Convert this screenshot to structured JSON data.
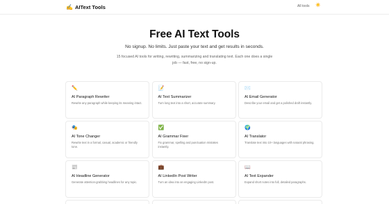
{
  "header": {
    "brand_icon": "✍️",
    "brand_name": "AIText Tools",
    "nav_link": "All tools",
    "theme_toggle_icon": "☀️"
  },
  "hero": {
    "title": "Free AI Text Tools",
    "subtitle": "No signup. No limits. Just paste your text and get results in seconds.",
    "description": "15 focused AI tools for writing, rewriting, summarizing and translating text. Each one does a single job — fast, free, no sign-up."
  },
  "tools": [
    {
      "icon": "✏️",
      "title": "AI Paragraph Rewriter",
      "desc": "Rewrite any paragraph while keeping its meaning intact."
    },
    {
      "icon": "📝",
      "title": "AI Text Summarizer",
      "desc": "Turn long text into a short, accurate summary."
    },
    {
      "icon": "✉️",
      "title": "AI Email Generator",
      "desc": "Describe your email and get a polished draft instantly."
    },
    {
      "icon": "🎭",
      "title": "AI Tone Changer",
      "desc": "Rewrite text in a formal, casual, academic or friendly tone."
    },
    {
      "icon": "✅",
      "title": "AI Grammar Fixer",
      "desc": "Fix grammar, spelling and punctuation mistakes instantly."
    },
    {
      "icon": "🌍",
      "title": "AI Translator",
      "desc": "Translate text into 10+ languages with natural phrasing."
    },
    {
      "icon": "📰",
      "title": "AI Headline Generator",
      "desc": "Generate attention-grabbing headlines for any topic."
    },
    {
      "icon": "💼",
      "title": "AI LinkedIn Post Writer",
      "desc": "Turn an idea into an engaging LinkedIn post."
    },
    {
      "icon": "📖",
      "title": "AI Text Expander",
      "desc": "Expand short notes into full, detailed paragraphs."
    }
  ],
  "icon_names": {
    "brand": "writing-hand-icon",
    "theme": "sun-icon"
  }
}
